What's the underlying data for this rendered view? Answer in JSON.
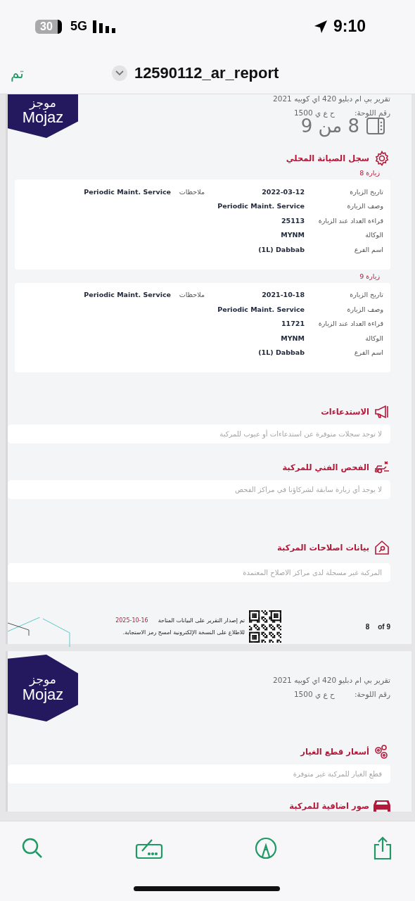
{
  "status_bar": {
    "battery": "30",
    "network": "5G",
    "time": "9:10"
  },
  "nav": {
    "done": "تم",
    "title": "12590112_ar_report"
  },
  "page_indicator": "8 من 9",
  "pages": [
    {
      "logo": {
        "arabic": "موجز",
        "latin": "Mojaz"
      },
      "report_title": "تقرير بي ام دبليو 420 اي كوبيه 2021",
      "plate_label": "رقم اللوحة:",
      "plate": "ح ع ي 1500",
      "cut_top": true,
      "sections": [
        {
          "kind": "maintenance",
          "title": "سجل الصيانة المحلي",
          "visits": [
            {
              "heading": "زيارة 8",
              "notes_label": "ملاحظات",
              "notes": "Periodic Maint. Service",
              "fields": [
                {
                  "label": "تاريخ الزيارة",
                  "value": "2022-03-12"
                },
                {
                  "label": "وصف الزيارة",
                  "value": "Periodic Maint. Service"
                },
                {
                  "label": "قراءة العداد عند الزيارة",
                  "value": "25113"
                },
                {
                  "label": "الوكالة",
                  "value": "MYNM"
                },
                {
                  "label": "اسم الفرع",
                  "value": "(1L) Dabbab"
                }
              ]
            },
            {
              "heading": "زيارة 9",
              "notes_label": "ملاحظات",
              "notes": "Periodic Maint. Service",
              "fields": [
                {
                  "label": "تاريخ الزيارة",
                  "value": "2021-10-18"
                },
                {
                  "label": "وصف الزيارة",
                  "value": "Periodic Maint. Service"
                },
                {
                  "label": "قراءة العداد عند الزيارة",
                  "value": "11721"
                },
                {
                  "label": "الوكالة",
                  "value": "MYNM"
                },
                {
                  "label": "اسم الفرع",
                  "value": "(1L) Dabbab"
                }
              ]
            }
          ]
        },
        {
          "kind": "recalls",
          "title": "الاستدعاءات",
          "message": "لا توجد سجلات متوفرة عن استدعاءات أو عيوب للمركبة"
        },
        {
          "kind": "inspection",
          "title": "الفحص الفني للمركبة",
          "message": "لا يوجد أي زيارة سابقة لشركاؤنا في مراكز الفحص"
        },
        {
          "kind": "repairs",
          "title": "بيانات اصلاحات المركبة",
          "message": "المركبة غير مسجلة لدى مراكز الاصلاح المعتمدة"
        }
      ],
      "footer": {
        "issued": "تم إصدار التقرير على البيانات المتاحة",
        "date": "2025-10-16",
        "scan": "للاطلاع على النسخة الإلكترونية امسح رمز الاستجابة.",
        "page": "8",
        "of": "of 9"
      }
    },
    {
      "logo": {
        "arabic": "موجز",
        "latin": "Mojaz"
      },
      "report_title": "تقرير بي ام دبليو 420 اي كوبيه 2021",
      "plate_label": "رقم اللوحة:",
      "plate": "ح ع ي 1500",
      "cut_top": false,
      "sections": [
        {
          "kind": "parts",
          "title": "أسعار قطع الغيار",
          "message": "قطع الغيار للمركبة غير متوفرة"
        },
        {
          "kind": "photos",
          "title": "صور اضافية للمركبة"
        }
      ]
    }
  ]
}
